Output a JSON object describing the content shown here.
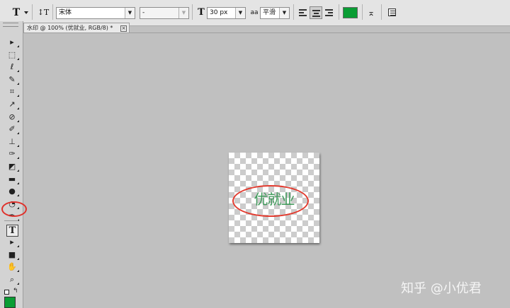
{
  "options_bar": {
    "tool_icon": "T",
    "orientation_icon": "text-orientation-icon",
    "font_family": "宋体",
    "font_style": "-",
    "font_size_icon": "T",
    "font_size": "30 px",
    "antialias_icon": "aa",
    "antialias": "平滑",
    "text_color": "#0a9d34"
  },
  "document_tab": {
    "title": "水印 @ 100% (优就业, RGB/8) *",
    "close": "×"
  },
  "canvas": {
    "watermark_text": "优就业",
    "watermark_color": "#3f9a5a",
    "highlight_color": "#e23b2f"
  },
  "toolbar": {
    "tools": [
      {
        "name": "move-tool",
        "glyph": "▸"
      },
      {
        "name": "marquee-tool",
        "glyph": "⬚"
      },
      {
        "name": "lasso-tool",
        "glyph": "ℓ"
      },
      {
        "name": "quick-selection-tool",
        "glyph": "✎"
      },
      {
        "name": "crop-tool",
        "glyph": "⌗"
      },
      {
        "name": "eyedropper-tool",
        "glyph": "↗"
      },
      {
        "name": "healing-brush-tool",
        "glyph": "⊘"
      },
      {
        "name": "brush-tool",
        "glyph": "✐"
      },
      {
        "name": "clone-stamp-tool",
        "glyph": "⊥"
      },
      {
        "name": "history-brush-tool",
        "glyph": "✑"
      },
      {
        "name": "eraser-tool",
        "glyph": "◩"
      },
      {
        "name": "gradient-tool",
        "glyph": "▬"
      },
      {
        "name": "blur-tool",
        "glyph": "●"
      },
      {
        "name": "dodge-tool",
        "glyph": "◔"
      },
      {
        "name": "pen-tool",
        "glyph": "✒"
      }
    ],
    "type_tool": "T",
    "lower_tools": [
      {
        "name": "path-selection-tool",
        "glyph": "▸"
      },
      {
        "name": "shape-tool",
        "glyph": "■"
      },
      {
        "name": "hand-tool",
        "glyph": "✋"
      },
      {
        "name": "zoom-tool",
        "glyph": "⌕"
      }
    ],
    "foreground_color": "#0a9d34"
  },
  "credit": "知乎 @小优君"
}
